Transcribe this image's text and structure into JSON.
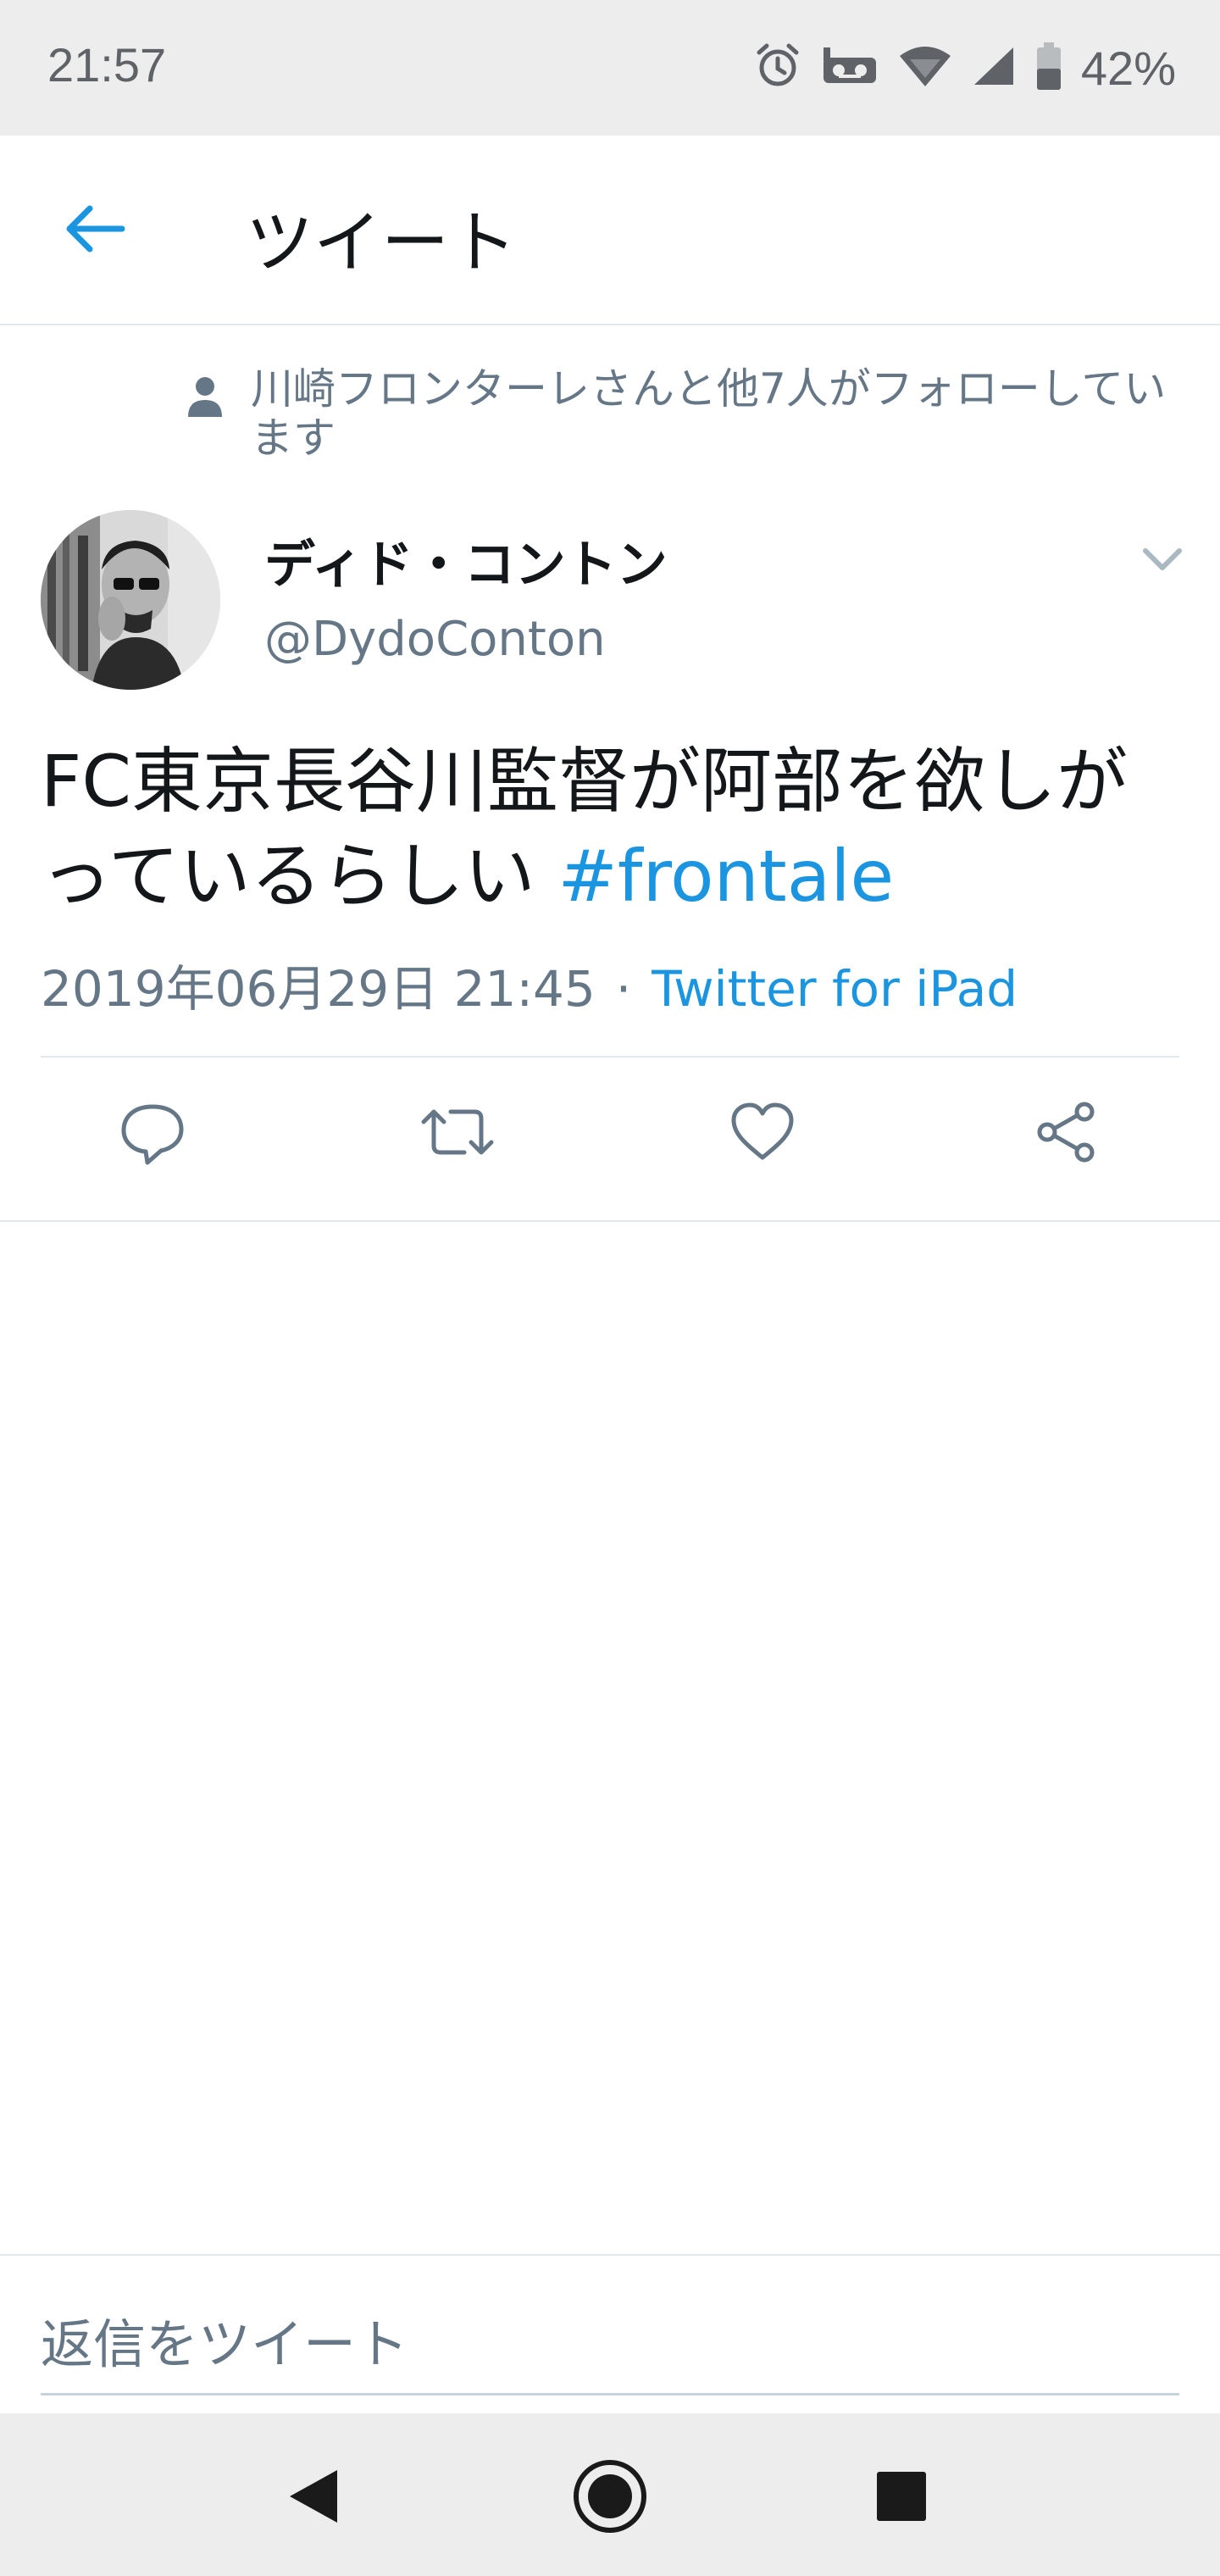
{
  "status_bar": {
    "time": "21:57",
    "battery_percent": "42%",
    "icons": [
      "alarm-icon",
      "voicemail-icon",
      "wifi-icon",
      "signal-icon",
      "battery-icon"
    ]
  },
  "header": {
    "title": "ツイート",
    "back_icon": "arrow-left-icon"
  },
  "social_context": {
    "text": "川崎フロンターレさんと他7人がフォローしています",
    "icon": "person-icon"
  },
  "tweet": {
    "author_name": "ディド・コントン",
    "author_handle": "@DydoConton",
    "text_main": "FC東京長谷川監督が阿部を欲しがっているらしい ",
    "hashtag": "#frontale",
    "timestamp": "2019年06月29日 21:45",
    "separator": "·",
    "source": "Twitter for iPad"
  },
  "actions": [
    {
      "name": "reply",
      "icon": "reply-icon"
    },
    {
      "name": "retweet",
      "icon": "retweet-icon"
    },
    {
      "name": "like",
      "icon": "heart-icon"
    },
    {
      "name": "share",
      "icon": "share-icon"
    }
  ],
  "reply_composer": {
    "placeholder": "返信をツイート"
  },
  "colors": {
    "accent": "#1b95e0",
    "secondary_text": "#657786",
    "primary_text": "#14171a",
    "divider": "#e1e8ed",
    "system_bar": "#ededed"
  }
}
